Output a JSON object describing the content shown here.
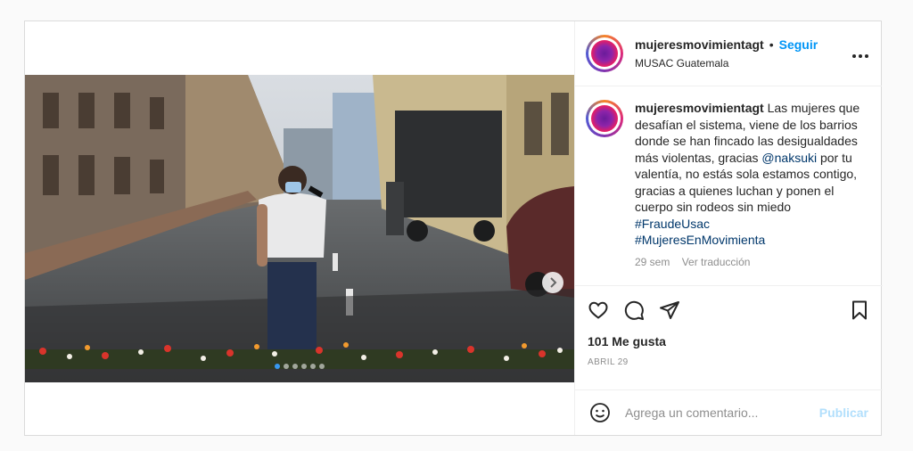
{
  "post": {
    "username": "mujeresmovimientagt",
    "separator": "•",
    "follow_label": "Seguir",
    "location": "MUSAC Guatemala",
    "more_label": "•••",
    "caption_text": "Las mujeres que desafían el sistema, viene de los barrios donde se han fincado las desigualdades más violentas, gracias ",
    "mention": "@naksuki",
    "caption_text2": " por tu valentía, no estás sola estamos contigo, gracias a quienes luchan y ponen el cuerpo sin rodeos sin miedo",
    "hashtag1": "#FraudeUsac",
    "hashtag2": "#MujeresEnMovimienta",
    "time_ago": "29 sem",
    "translate_label": "Ver traducción",
    "likes": "101 Me gusta",
    "date": "ABRIL 29",
    "comment_placeholder": "Agrega un comentario...",
    "publish_label": "Publicar"
  },
  "carousel": {
    "total": 6,
    "active_index": 0
  },
  "icons": {
    "like": "heart-icon",
    "comment": "comment-bubble-icon",
    "share": "paper-plane-icon",
    "save": "bookmark-icon",
    "emoji": "smiley-icon",
    "next": "chevron-right-icon"
  },
  "colors": {
    "accent": "#0095f6",
    "link": "#00376b",
    "muted": "#8e8e8e",
    "publish_disabled": "#b2dffc"
  }
}
